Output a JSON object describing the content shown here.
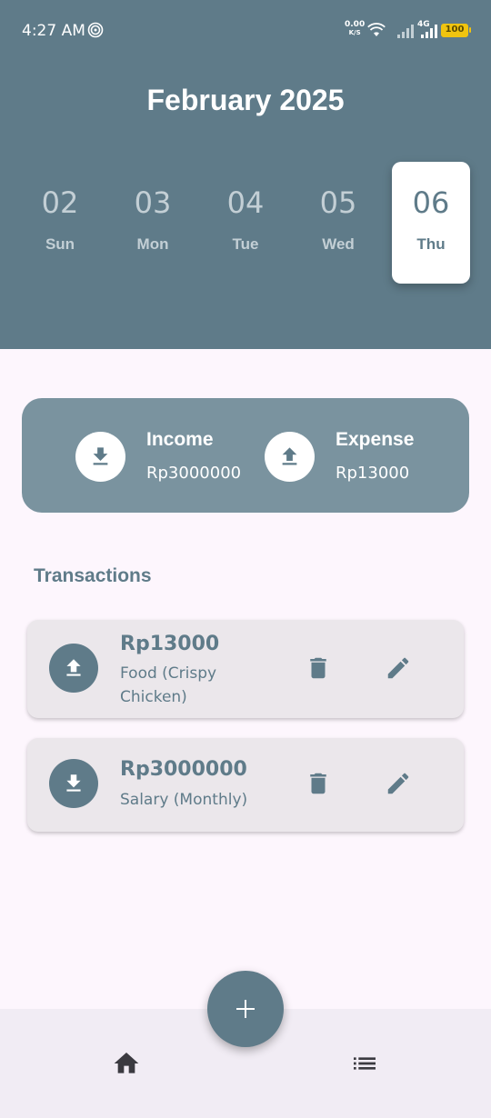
{
  "status_bar": {
    "time": "4:27 AM",
    "net_speed": "0.00",
    "net_unit": "K/S",
    "network_type": "4G",
    "battery": "100"
  },
  "calendar": {
    "month_title": "February 2025",
    "days": [
      {
        "num": "02",
        "name": "Sun",
        "selected": false
      },
      {
        "num": "03",
        "name": "Mon",
        "selected": false
      },
      {
        "num": "04",
        "name": "Tue",
        "selected": false
      },
      {
        "num": "05",
        "name": "Wed",
        "selected": false
      },
      {
        "num": "06",
        "name": "Thu",
        "selected": true
      }
    ]
  },
  "summary": {
    "income_label": "Income",
    "income_value": "Rp3000000",
    "income_icon": "download-icon",
    "expense_label": "Expense",
    "expense_value": "Rp13000",
    "expense_icon": "upload-icon"
  },
  "transactions": {
    "title": "Transactions",
    "items": [
      {
        "amount": "Rp13000",
        "description": "Food (Crispy Chicken)",
        "type": "expense",
        "icon": "upload-icon"
      },
      {
        "amount": "Rp3000000",
        "description": "Salary (Monthly)",
        "type": "income",
        "icon": "download-icon"
      }
    ]
  },
  "nav": {
    "home_icon": "home-icon",
    "list_icon": "list-icon",
    "fab_icon": "plus-icon"
  },
  "colors": {
    "primary": "#5f7b89",
    "summary_card": "#7a939f",
    "background": "#fdf6fd",
    "card": "#ebe7eb",
    "nav_bar": "#f1ecf4"
  }
}
